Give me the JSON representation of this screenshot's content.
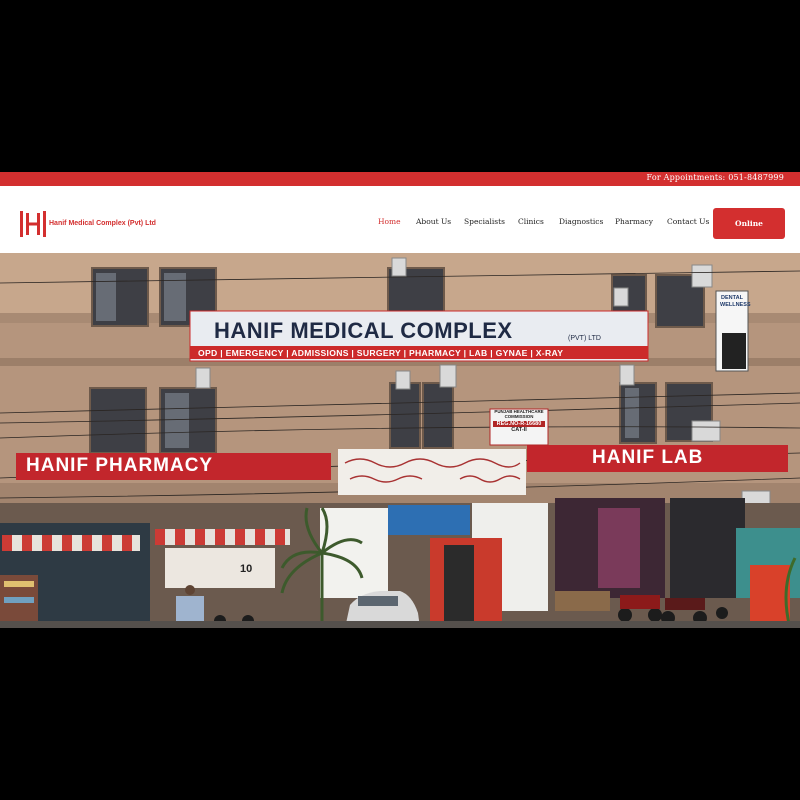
{
  "topbar": {
    "appointments": "For Appointments: 051-8487999"
  },
  "brand": {
    "name": "Hanif Medical Complex (Pvt) Ltd",
    "logo_letter": "H",
    "accent": "#d32f2f"
  },
  "nav": {
    "items": [
      "Home",
      "About Us",
      "Specialists",
      "Clinics",
      "Diagnostics",
      "Pharmacy",
      "Contact Us"
    ],
    "active": "Home",
    "cta": "Online Reporting"
  },
  "hero": {
    "main_sign": "HANIF MEDICAL COMPLEX",
    "main_sign_sub": "(PVT) LTD",
    "services": "OPD | EMERGENCY | ADMISSIONS | SURGERY | PHARMACY | LAB | GYNAE | X-RAY",
    "pharmacy_sign": "HANIF PHARMACY",
    "lab_sign": "HANIF LAB",
    "commission_line1": "PUNJAB HEALTHCARE",
    "commission_line2": "COMMISSION",
    "commission_reg": "REG.NO-R-16680",
    "commission_cat": "CAT-II",
    "dental_sign": "DENTAL WELLNESS",
    "shop_number": "10"
  }
}
